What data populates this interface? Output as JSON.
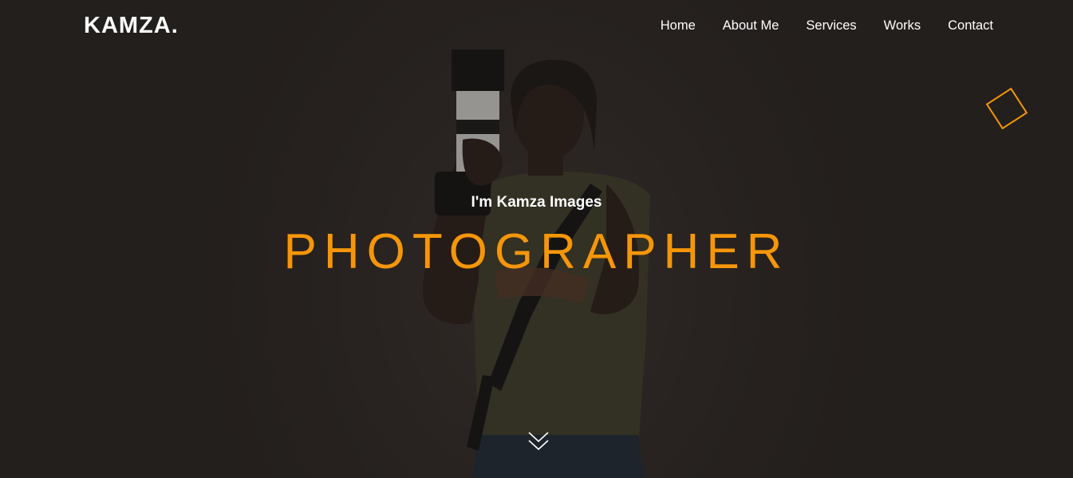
{
  "brand": {
    "logo_text": "KAMZA."
  },
  "nav": {
    "items": [
      {
        "label": "Home"
      },
      {
        "label": "About Me"
      },
      {
        "label": "Services"
      },
      {
        "label": "Works"
      },
      {
        "label": "Contact"
      }
    ]
  },
  "hero": {
    "intro": "I'm Kamza Images",
    "headline": "PHOTOGRAPHER",
    "scroll_icon": "double-chevron-down-icon",
    "decoration_icon": "diamond-outline-icon",
    "background_image": "photographer-holding-camera"
  },
  "colors": {
    "accent": "#f5960a",
    "background": "#2b2523",
    "text": "#ffffff"
  }
}
